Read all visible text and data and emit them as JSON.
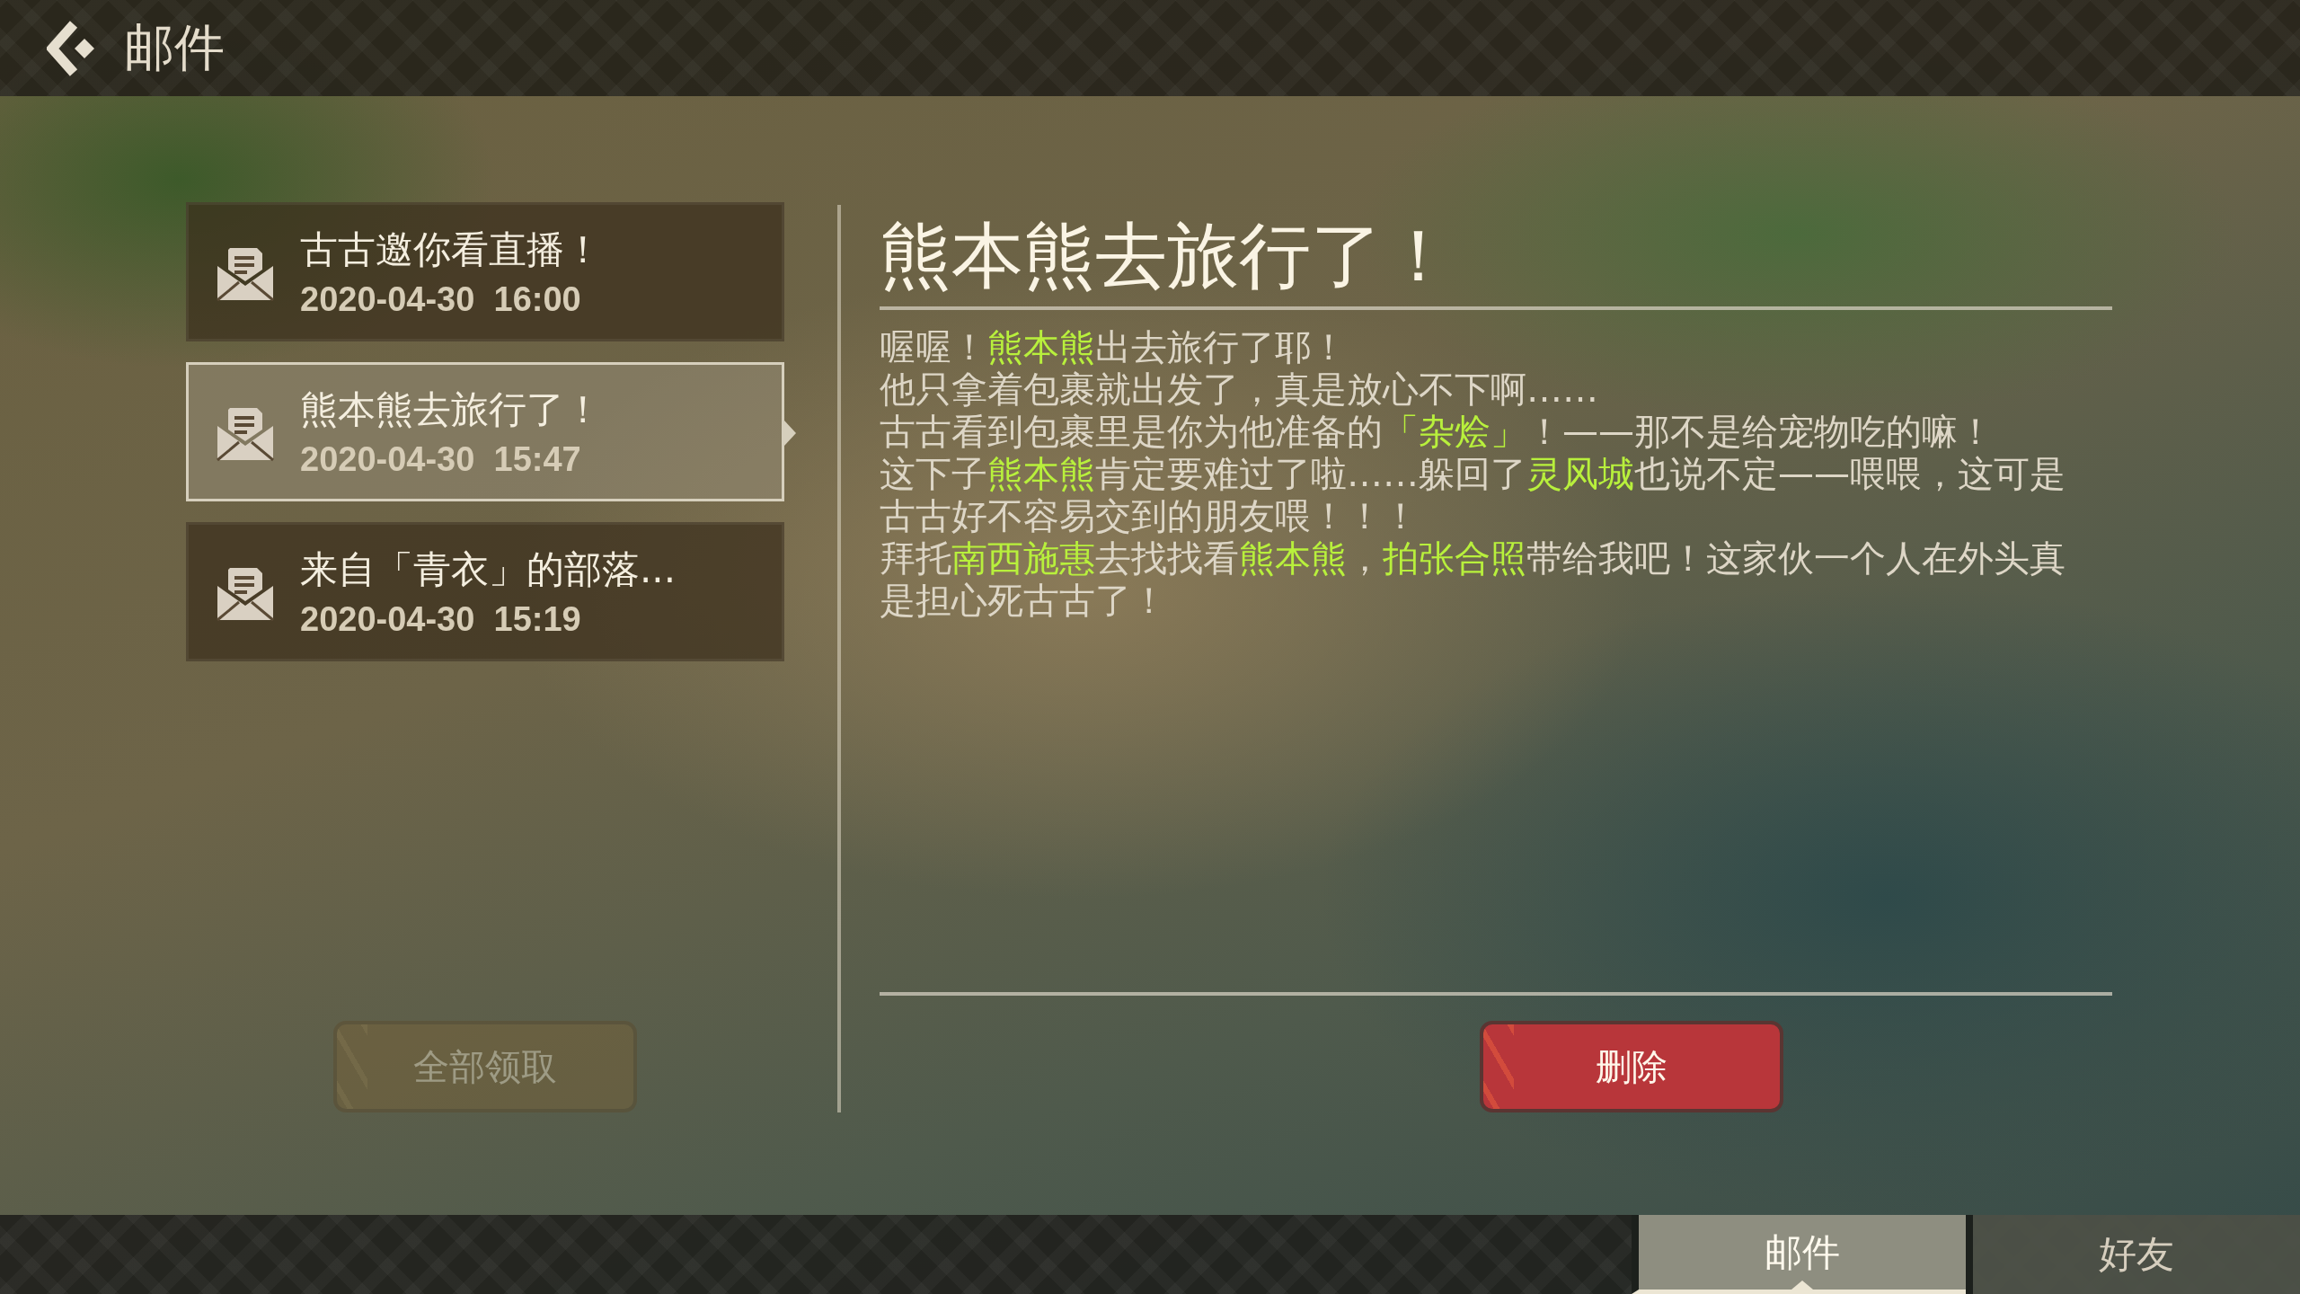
{
  "header": {
    "title": "邮件"
  },
  "mails": [
    {
      "subject": "古古邀你看直播！",
      "date": "2020-04-30  16:00",
      "selected": false
    },
    {
      "subject": "熊本熊去旅行了！",
      "date": "2020-04-30  15:47",
      "selected": true
    },
    {
      "subject": "来自「青衣」的部落...",
      "date": "2020-04-30  15:19",
      "selected": false
    }
  ],
  "detail": {
    "title": "熊本熊去旅行了！",
    "paragraphs": [
      "喔喔！**熊本熊**出去旅行了耶！",
      "他只拿着包裹就出发了，真是放心不下啊……",
      "古古看到包裹里是你为他准备的**「杂烩」**！——那不是给宠物吃的嘛！",
      "这下子**熊本熊**肯定要难过了啦……躲回了**灵风城**也说不定——喂喂，这可是古古好不容易交到的朋友喂！！！",
      "拜托**南西施惠**去找找看**熊本熊**，**拍张合照**带给我吧！这家伙一个人在外头真是担心死古古了！"
    ]
  },
  "buttons": [
    {
      "label": "全部领取",
      "kind": "claim-all",
      "disabled": true
    },
    {
      "label": "删除",
      "kind": "delete",
      "disabled": false
    }
  ],
  "tabs": [
    {
      "label": "邮件",
      "selected": true
    },
    {
      "label": "好友",
      "selected": false
    }
  ]
}
